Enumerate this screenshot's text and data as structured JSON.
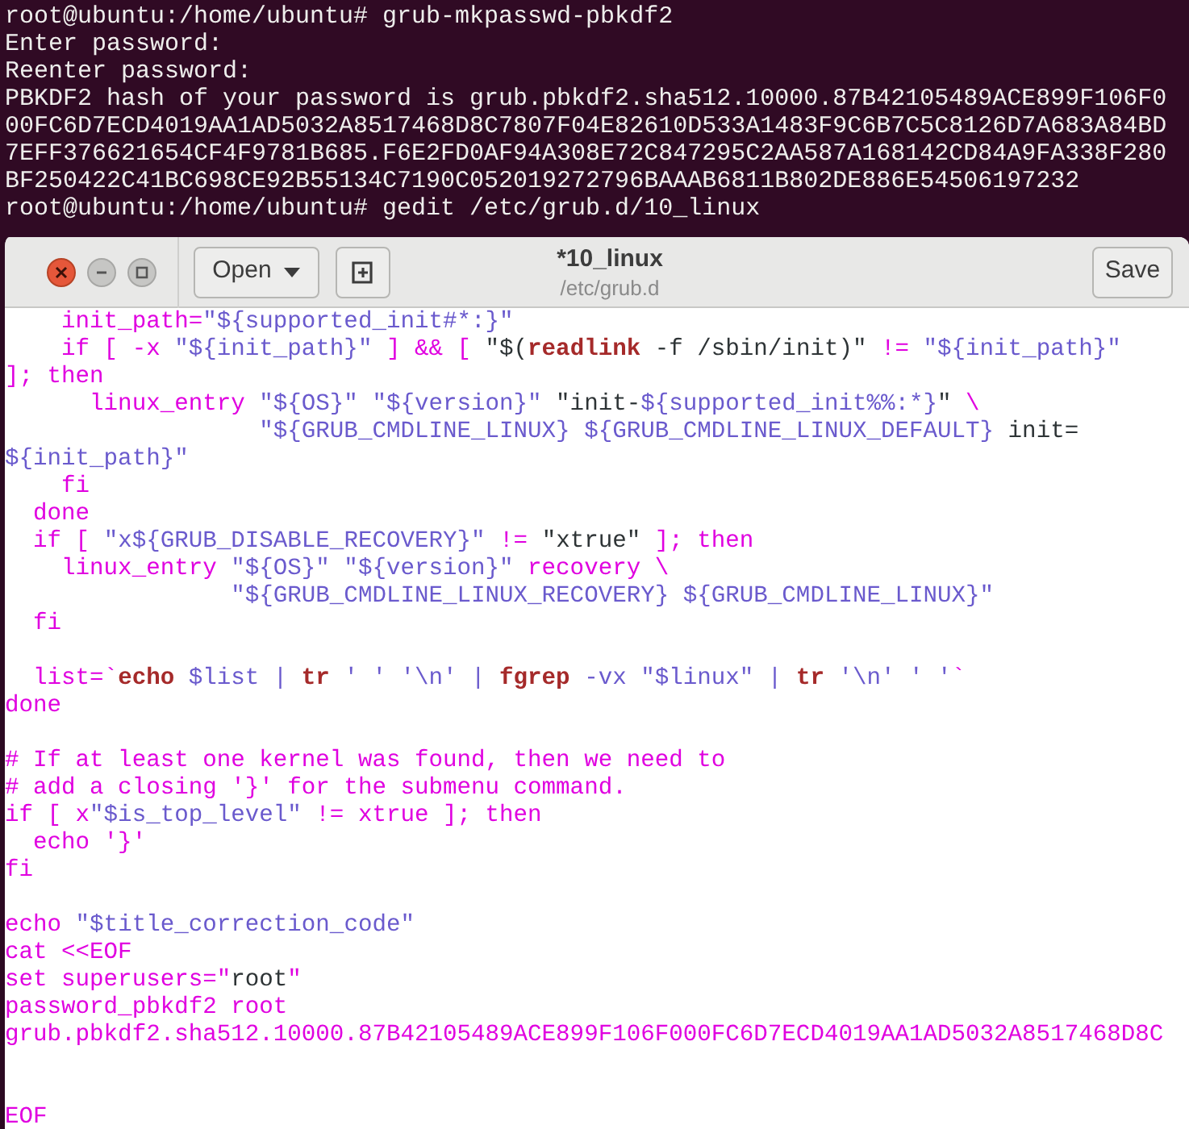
{
  "terminal": {
    "lines": [
      "root@ubuntu:/home/ubuntu# grub-mkpasswd-pbkdf2",
      "Enter password:",
      "Reenter password:",
      "PBKDF2 hash of your password is grub.pbkdf2.sha512.10000.87B42105489ACE899F106F0",
      "00FC6D7ECD4019AA1AD5032A8517468D8C7807F04E82610D533A1483F9C6B7C5C8126D7A683A84BD",
      "7EFF376621654CF4F9781B685.F6E2FD0AF94A308E72C847295C2AA587A168142CD84A9FA338F280",
      "BF250422C41BC698CE92B55134C7190C052019272796BAAAB6811B802DE886E54506197232",
      "root@ubuntu:/home/ubuntu# gedit /etc/grub.d/10_linux"
    ]
  },
  "editor": {
    "open_button": "Open",
    "save_button": "Save",
    "title": "*10_linux",
    "subtitle": "/etc/grub.d",
    "lines": [
      {
        "kind": "code",
        "segments": [
          {
            "kind": "code",
            "text": "    init_path="
          },
          {
            "kind": "string",
            "text": "\"${supported_init#*:}\""
          }
        ]
      },
      {
        "kind": "code",
        "segments": [
          {
            "kind": "code",
            "text": "    if [ -x "
          },
          {
            "kind": "string",
            "text": "\"${init_path}\""
          },
          {
            "kind": "code",
            "text": " ] && [ "
          },
          {
            "kind": "plain",
            "text": "\"$("
          },
          {
            "kind": "keyword",
            "text": "readlink"
          },
          {
            "kind": "plain",
            "text": " -f /sbin/init)\""
          },
          {
            "kind": "code",
            "text": " != "
          },
          {
            "kind": "string",
            "text": "\"${init_path}\""
          }
        ]
      },
      {
        "kind": "code",
        "segments": [
          {
            "kind": "code",
            "text": "]; then"
          }
        ]
      },
      {
        "kind": "code",
        "segments": [
          {
            "kind": "code",
            "text": "      linux_entry "
          },
          {
            "kind": "string",
            "text": "\"${OS}\" \"${version}\""
          },
          {
            "kind": "plain",
            "text": " \"init-"
          },
          {
            "kind": "string",
            "text": "${supported_init%%:*}"
          },
          {
            "kind": "plain",
            "text": "\""
          },
          {
            "kind": "code",
            "text": " \\"
          }
        ]
      },
      {
        "kind": "code",
        "segments": [
          {
            "kind": "string",
            "text": "                  \"${GRUB_CMDLINE_LINUX} ${GRUB_CMDLINE_LINUX_DEFAULT}"
          },
          {
            "kind": "plain",
            "text": " init="
          }
        ]
      },
      {
        "kind": "code",
        "segments": [
          {
            "kind": "string",
            "text": "${init_path}\""
          }
        ]
      },
      {
        "kind": "code",
        "segments": [
          {
            "kind": "code",
            "text": "    fi"
          }
        ]
      },
      {
        "kind": "code",
        "segments": [
          {
            "kind": "code",
            "text": "  done"
          }
        ]
      },
      {
        "kind": "code",
        "segments": [
          {
            "kind": "code",
            "text": "  if [ "
          },
          {
            "kind": "string",
            "text": "\"x${GRUB_DISABLE_RECOVERY}\""
          },
          {
            "kind": "code",
            "text": " != "
          },
          {
            "kind": "plain",
            "text": "\"xtrue\""
          },
          {
            "kind": "code",
            "text": " ]; then"
          }
        ]
      },
      {
        "kind": "code",
        "segments": [
          {
            "kind": "code",
            "text": "    linux_entry "
          },
          {
            "kind": "string",
            "text": "\"${OS}\" \"${version}\""
          },
          {
            "kind": "code",
            "text": " recovery \\"
          }
        ]
      },
      {
        "kind": "code",
        "segments": [
          {
            "kind": "string",
            "text": "                \"${GRUB_CMDLINE_LINUX_RECOVERY} ${GRUB_CMDLINE_LINUX}\""
          }
        ]
      },
      {
        "kind": "code",
        "segments": [
          {
            "kind": "code",
            "text": "  fi"
          }
        ]
      },
      {
        "kind": "blank"
      },
      {
        "kind": "code",
        "segments": [
          {
            "kind": "code",
            "text": "  list=`"
          },
          {
            "kind": "keyword",
            "text": "echo"
          },
          {
            "kind": "string",
            "text": " $list | "
          },
          {
            "kind": "keyword",
            "text": "tr"
          },
          {
            "kind": "string",
            "text": " ' ' '\\n' | "
          },
          {
            "kind": "keyword",
            "text": "fgrep"
          },
          {
            "kind": "string",
            "text": " -vx \"$linux\" | "
          },
          {
            "kind": "keyword",
            "text": "tr"
          },
          {
            "kind": "string",
            "text": " '\\n' ' '"
          },
          {
            "kind": "code",
            "text": "`"
          }
        ]
      },
      {
        "kind": "code",
        "segments": [
          {
            "kind": "code",
            "text": "done"
          }
        ]
      },
      {
        "kind": "blank"
      },
      {
        "kind": "code",
        "segments": [
          {
            "kind": "code",
            "text": "# If at least one kernel was found, then we need to"
          }
        ]
      },
      {
        "kind": "code",
        "segments": [
          {
            "kind": "code",
            "text": "# add a closing '}' for the submenu command."
          }
        ]
      },
      {
        "kind": "code",
        "segments": [
          {
            "kind": "code",
            "text": "if [ x"
          },
          {
            "kind": "string",
            "text": "\"$is_top_level\""
          },
          {
            "kind": "code",
            "text": " != xtrue ]; then"
          }
        ]
      },
      {
        "kind": "code",
        "segments": [
          {
            "kind": "code",
            "text": "  echo '}'"
          }
        ]
      },
      {
        "kind": "code",
        "segments": [
          {
            "kind": "code",
            "text": "fi"
          }
        ]
      },
      {
        "kind": "blank"
      },
      {
        "kind": "code",
        "segments": [
          {
            "kind": "code",
            "text": "echo "
          },
          {
            "kind": "string",
            "text": "\"$title_correction_code\""
          }
        ]
      },
      {
        "kind": "code",
        "segments": [
          {
            "kind": "code",
            "text": "cat <<EOF"
          }
        ]
      },
      {
        "kind": "code",
        "segments": [
          {
            "kind": "code",
            "text": "set superusers=\""
          },
          {
            "kind": "plain",
            "text": "root"
          },
          {
            "kind": "code",
            "text": "\""
          }
        ]
      },
      {
        "kind": "code",
        "segments": [
          {
            "kind": "code",
            "text": "password_pbkdf2 root"
          }
        ]
      },
      {
        "kind": "code",
        "segments": [
          {
            "kind": "code",
            "text": "grub.pbkdf2.sha512.10000.87B42105489ACE899F106F000FC6D7ECD4019AA1AD5032A8517468D8C"
          }
        ]
      },
      {
        "kind": "blank"
      },
      {
        "kind": "blank"
      },
      {
        "kind": "code",
        "segments": [
          {
            "kind": "code",
            "text": "EOF"
          }
        ]
      }
    ]
  }
}
